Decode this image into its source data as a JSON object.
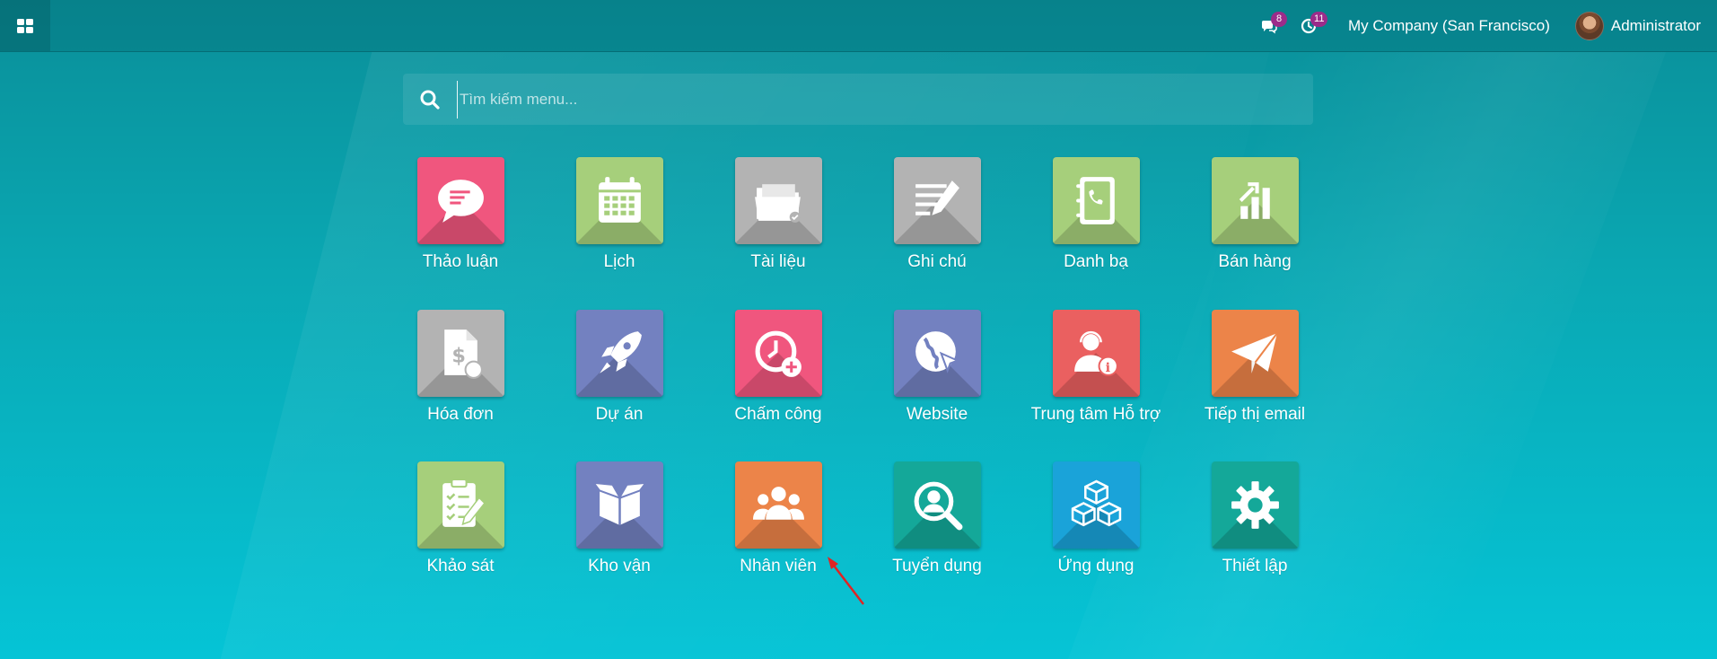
{
  "topbar": {
    "messages_badge": "8",
    "activities_badge": "11",
    "company": "My Company (San Francisco)",
    "user": "Administrator"
  },
  "search": {
    "placeholder": "Tìm kiếm menu..."
  },
  "apps": [
    {
      "label": "Thảo luận",
      "color": "#f0567e",
      "icon": "chat-bubble-icon"
    },
    {
      "label": "Lịch",
      "color": "#a6cf7b",
      "icon": "calendar-icon"
    },
    {
      "label": "Tài liệu",
      "color": "#b3b3b3",
      "icon": "folder-icon"
    },
    {
      "label": "Ghi chú",
      "color": "#b3b3b3",
      "icon": "note-pencil-icon"
    },
    {
      "label": "Danh bạ",
      "color": "#a6cf7b",
      "icon": "phone-book-icon"
    },
    {
      "label": "Bán hàng",
      "color": "#a6cf7b",
      "icon": "sales-chart-icon"
    },
    {
      "label": "Hóa đơn",
      "color": "#b3b3b3",
      "icon": "invoice-icon"
    },
    {
      "label": "Dự án",
      "color": "#7381c0",
      "icon": "rocket-icon"
    },
    {
      "label": "Chấm công",
      "color": "#f0567e",
      "icon": "clock-plus-icon"
    },
    {
      "label": "Website",
      "color": "#7381c0",
      "icon": "globe-cursor-icon"
    },
    {
      "label": "Trung tâm Hỗ trợ",
      "color": "#ea6060",
      "icon": "helpdesk-agent-icon"
    },
    {
      "label": "Tiếp thị email",
      "color": "#ec8449",
      "icon": "paper-plane-icon"
    },
    {
      "label": "Khảo sát",
      "color": "#a6cf7b",
      "icon": "survey-checklist-icon"
    },
    {
      "label": "Kho vận",
      "color": "#7381c0",
      "icon": "box-icon"
    },
    {
      "label": "Nhân viên",
      "color": "#ec8449",
      "icon": "people-group-icon"
    },
    {
      "label": "Tuyển dụng",
      "color": "#14a899",
      "icon": "person-search-icon"
    },
    {
      "label": "Ứng dụng",
      "color": "#1aa3d9",
      "icon": "cubes-icon"
    },
    {
      "label": "Thiết lập",
      "color": "#14a899",
      "icon": "gear-icon"
    }
  ],
  "annotation_color": "#e02424"
}
